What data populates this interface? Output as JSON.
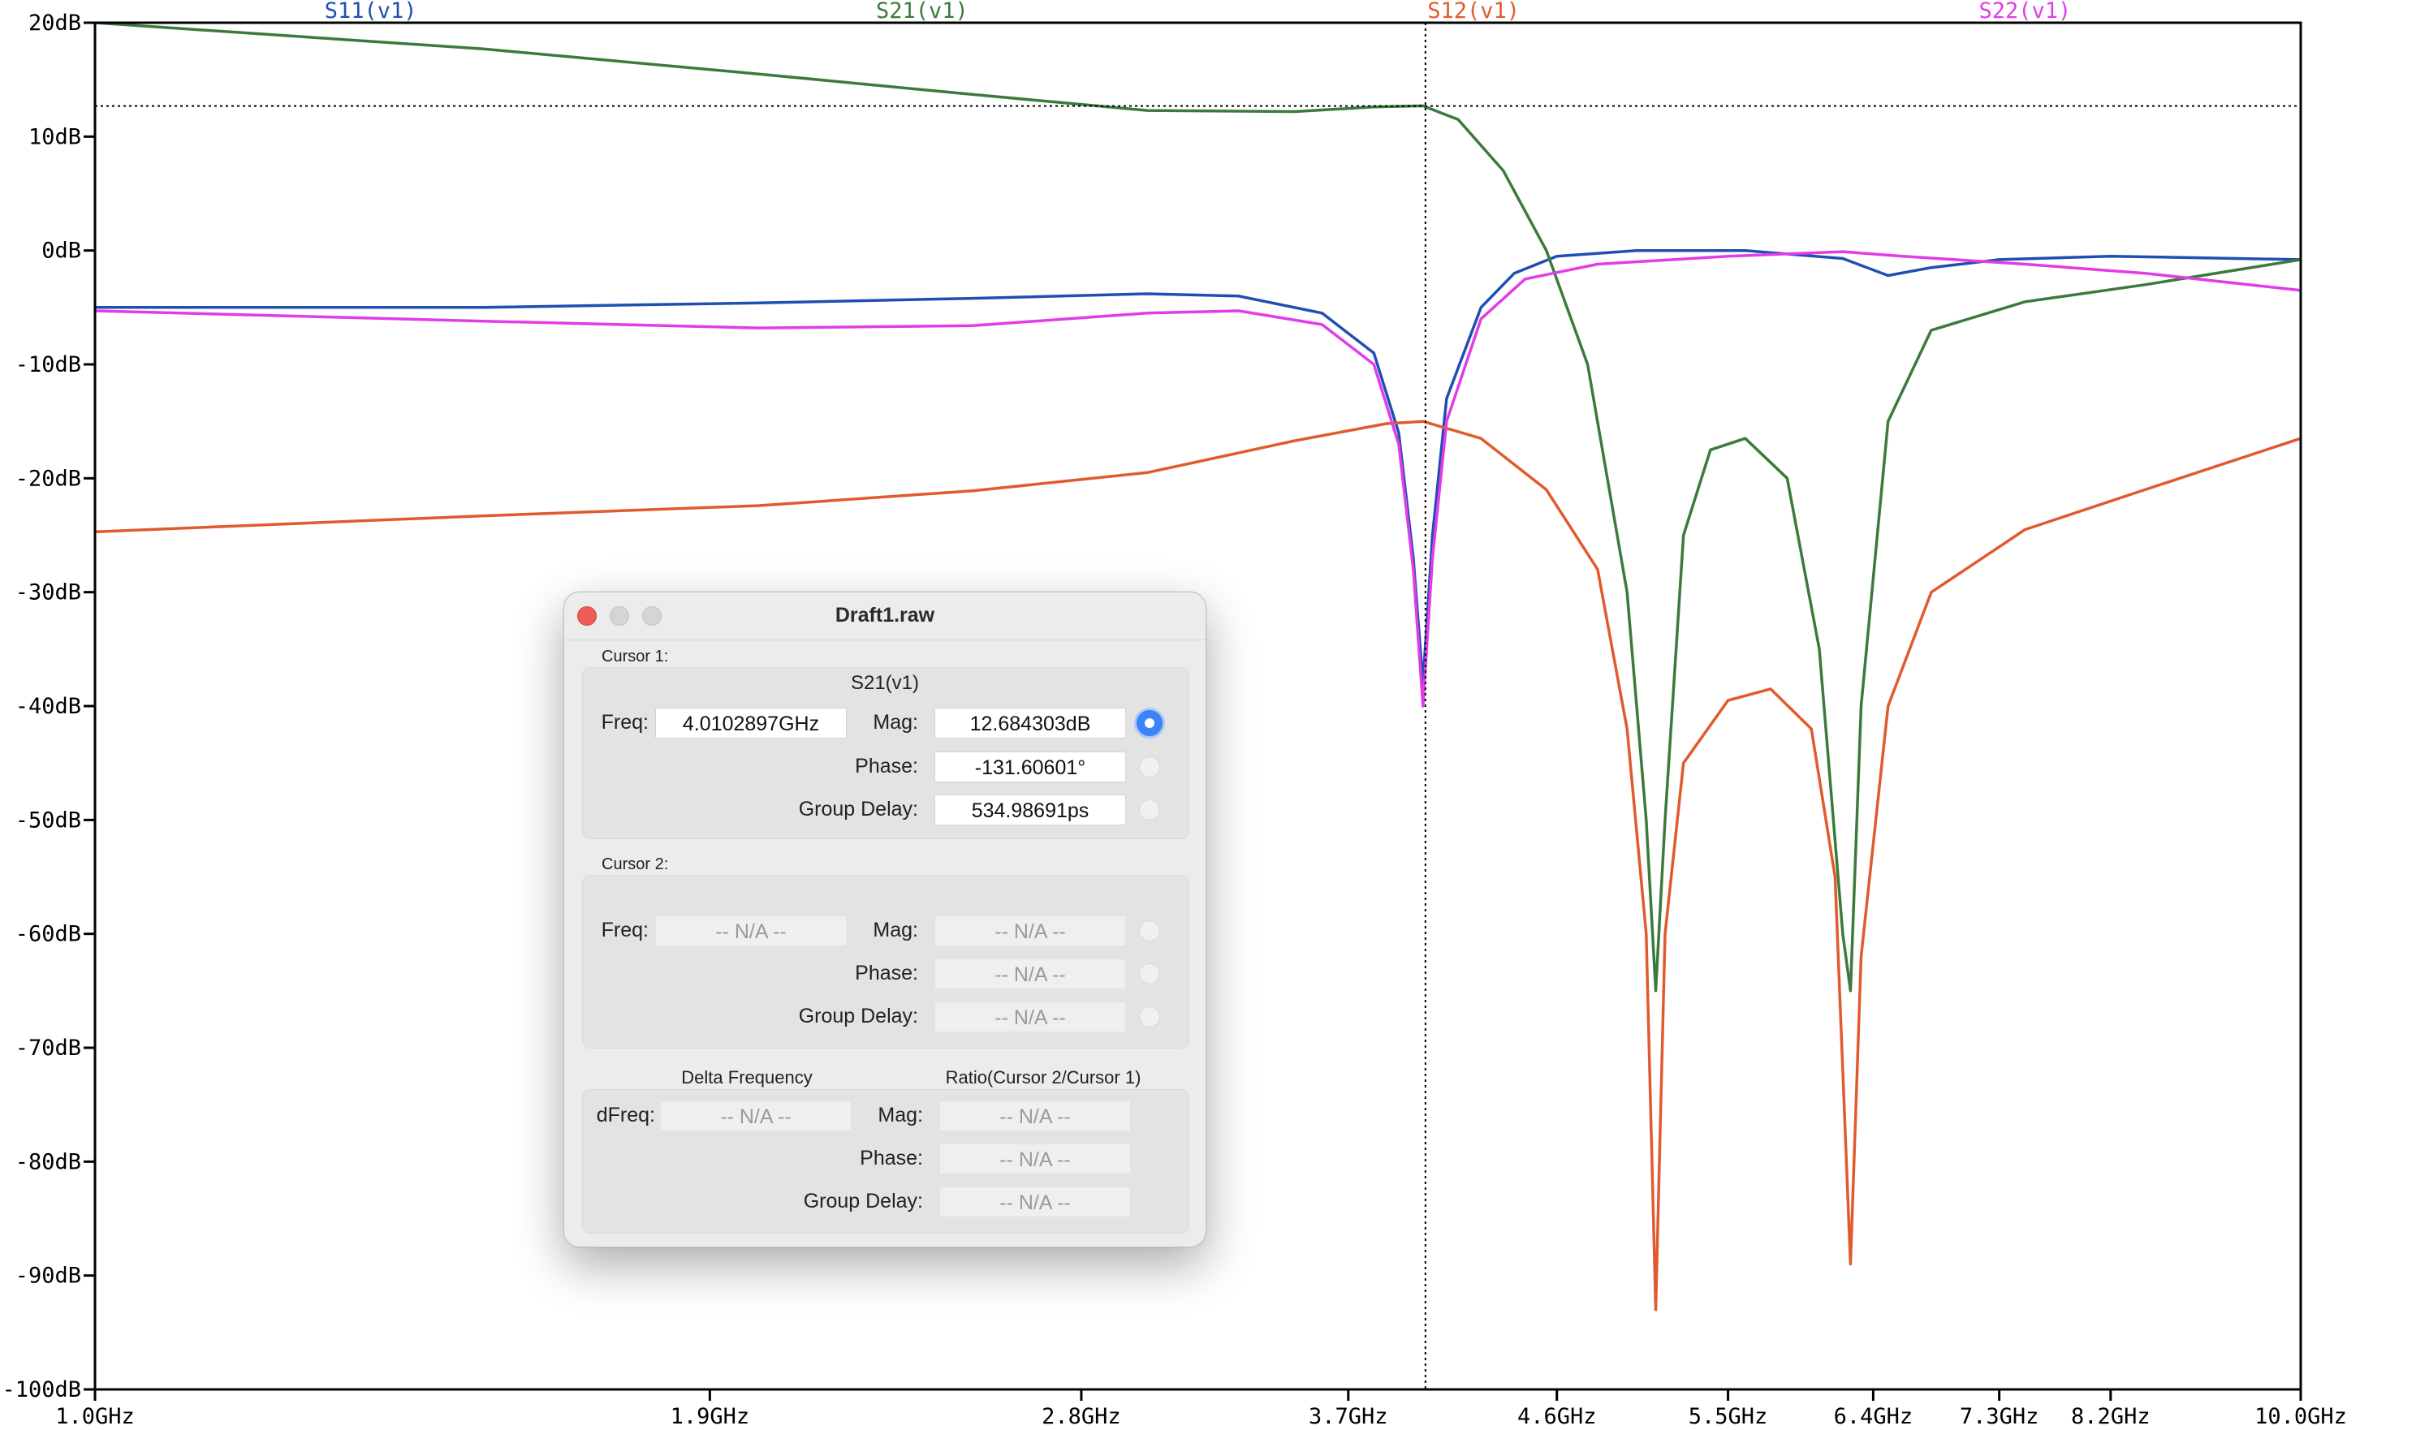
{
  "plot": {
    "y_axis_labels": [
      "20dB",
      "10dB",
      "0dB",
      "-10dB",
      "-20dB",
      "-30dB",
      "-40dB",
      "-50dB",
      "-60dB",
      "-70dB",
      "-80dB",
      "-90dB",
      "-100dB"
    ],
    "x_axis_labels": [
      "1.0GHz",
      "1.9GHz",
      "2.8GHz",
      "3.7GHz",
      "4.6GHz",
      "5.5GHz",
      "6.4GHz",
      "7.3GHz",
      "8.2GHz",
      "10.0GHz"
    ],
    "traces": [
      {
        "name": "S11(v1)",
        "color": "#1f4fb3"
      },
      {
        "name": "S21(v1)",
        "color": "#3c7a3c"
      },
      {
        "name": "S12(v1)",
        "color": "#e15a2d"
      },
      {
        "name": "S22(v1)",
        "color": "#e23ce6"
      }
    ],
    "cursor_color": "#000000"
  },
  "chart_data": {
    "type": "line",
    "x_scale": "log",
    "x_unit": "GHz",
    "y_unit": "dB",
    "xlim": [
      1.0,
      10.0
    ],
    "ylim": [
      -100,
      20
    ],
    "grid": false,
    "x_ticks": [
      1.0,
      1.9,
      2.8,
      3.7,
      4.6,
      5.5,
      6.4,
      7.3,
      8.2,
      10.0
    ],
    "y_ticks": [
      20,
      10,
      0,
      -10,
      -20,
      -30,
      -40,
      -50,
      -60,
      -70,
      -80,
      -90,
      -100
    ],
    "cursor": {
      "x": 4.0102897,
      "y": 12.684303
    },
    "series": [
      {
        "name": "S11(v1)",
        "color": "#1f4fb3",
        "points": [
          [
            1.0,
            -5.0
          ],
          [
            1.5,
            -5.0
          ],
          [
            2.0,
            -4.6
          ],
          [
            2.5,
            -4.2
          ],
          [
            3.0,
            -3.8
          ],
          [
            3.3,
            -4.0
          ],
          [
            3.6,
            -5.5
          ],
          [
            3.8,
            -9
          ],
          [
            3.9,
            -16
          ],
          [
            3.96,
            -27
          ],
          [
            4.0,
            -38
          ],
          [
            4.04,
            -25
          ],
          [
            4.1,
            -13
          ],
          [
            4.25,
            -5
          ],
          [
            4.4,
            -2
          ],
          [
            4.6,
            -0.5
          ],
          [
            5.0,
            0
          ],
          [
            5.6,
            0
          ],
          [
            6.2,
            -0.7
          ],
          [
            6.5,
            -2.2
          ],
          [
            6.8,
            -1.5
          ],
          [
            7.3,
            -0.8
          ],
          [
            8.2,
            -0.5
          ],
          [
            10.0,
            -0.8
          ]
        ]
      },
      {
        "name": "S21(v1)",
        "color": "#3c7a3c",
        "points": [
          [
            1.0,
            20
          ],
          [
            1.5,
            17.7
          ],
          [
            2.0,
            15.5
          ],
          [
            2.5,
            13.7
          ],
          [
            3.0,
            12.3
          ],
          [
            3.5,
            12.2
          ],
          [
            3.8,
            12.6
          ],
          [
            4.0,
            12.7
          ],
          [
            4.15,
            11.5
          ],
          [
            4.35,
            7
          ],
          [
            4.55,
            0
          ],
          [
            4.75,
            -10
          ],
          [
            4.95,
            -30
          ],
          [
            5.05,
            -50
          ],
          [
            5.1,
            -65
          ],
          [
            5.15,
            -50
          ],
          [
            5.25,
            -25
          ],
          [
            5.4,
            -17.5
          ],
          [
            5.6,
            -16.5
          ],
          [
            5.85,
            -20
          ],
          [
            6.05,
            -35
          ],
          [
            6.2,
            -60
          ],
          [
            6.25,
            -65
          ],
          [
            6.32,
            -40
          ],
          [
            6.5,
            -15
          ],
          [
            6.8,
            -7
          ],
          [
            7.5,
            -4.5
          ],
          [
            8.5,
            -3
          ],
          [
            10.0,
            -0.8
          ]
        ]
      },
      {
        "name": "S12(v1)",
        "color": "#e15a2d",
        "points": [
          [
            1.0,
            -24.7
          ],
          [
            1.5,
            -23.3
          ],
          [
            2.0,
            -22.4
          ],
          [
            2.5,
            -21.1
          ],
          [
            3.0,
            -19.5
          ],
          [
            3.5,
            -16.7
          ],
          [
            3.85,
            -15.2
          ],
          [
            4.0,
            -15.0
          ],
          [
            4.25,
            -16.5
          ],
          [
            4.55,
            -21
          ],
          [
            4.8,
            -28
          ],
          [
            4.95,
            -42
          ],
          [
            5.05,
            -60
          ],
          [
            5.1,
            -93
          ],
          [
            5.15,
            -60
          ],
          [
            5.25,
            -45
          ],
          [
            5.5,
            -39.5
          ],
          [
            5.75,
            -38.5
          ],
          [
            6.0,
            -42
          ],
          [
            6.15,
            -55
          ],
          [
            6.25,
            -89
          ],
          [
            6.32,
            -62
          ],
          [
            6.5,
            -40
          ],
          [
            6.8,
            -30
          ],
          [
            7.5,
            -24.5
          ],
          [
            8.5,
            -21
          ],
          [
            10.0,
            -16.5
          ]
        ]
      },
      {
        "name": "S22(v1)",
        "color": "#e23ce6",
        "points": [
          [
            1.0,
            -5.3
          ],
          [
            1.5,
            -6.2
          ],
          [
            2.0,
            -6.8
          ],
          [
            2.5,
            -6.6
          ],
          [
            3.0,
            -5.5
          ],
          [
            3.3,
            -5.3
          ],
          [
            3.6,
            -6.5
          ],
          [
            3.8,
            -10
          ],
          [
            3.9,
            -17
          ],
          [
            3.96,
            -28
          ],
          [
            4.0,
            -40
          ],
          [
            4.04,
            -27
          ],
          [
            4.1,
            -15
          ],
          [
            4.25,
            -6
          ],
          [
            4.45,
            -2.5
          ],
          [
            4.8,
            -1.2
          ],
          [
            5.5,
            -0.5
          ],
          [
            6.2,
            -0.1
          ],
          [
            6.6,
            -0.5
          ],
          [
            7.5,
            -1.2
          ],
          [
            8.5,
            -2
          ],
          [
            10.0,
            -3.5
          ]
        ]
      }
    ]
  },
  "dialog": {
    "title": "Draft1.raw",
    "cursor1": {
      "section_label": "Cursor 1:",
      "trace_name": "S21(v1)",
      "freq_label": "Freq:",
      "freq_value": "4.0102897GHz",
      "mag_label": "Mag:",
      "mag_value": "12.684303dB",
      "phase_label": "Phase:",
      "phase_value": "-131.60601°",
      "group_delay_label": "Group Delay:",
      "group_delay_value": "534.98691ps"
    },
    "cursor2": {
      "section_label": "Cursor 2:",
      "freq_label": "Freq:",
      "freq_value": "-- N/A --",
      "mag_label": "Mag:",
      "mag_value": "-- N/A --",
      "phase_label": "Phase:",
      "phase_value": "-- N/A --",
      "group_delay_label": "Group Delay:",
      "group_delay_value": "-- N/A --"
    },
    "delta": {
      "delta_frequency_heading": "Delta Frequency",
      "ratio_heading": "Ratio(Cursor 2/Cursor 1)",
      "dfreq_label": "dFreq:",
      "dfreq_value": "-- N/A --",
      "mag_label": "Mag:",
      "mag_value": "-- N/A --",
      "phase_label": "Phase:",
      "phase_value": "-- N/A --",
      "group_delay_label": "Group Delay:",
      "group_delay_value": "-- N/A --"
    }
  }
}
